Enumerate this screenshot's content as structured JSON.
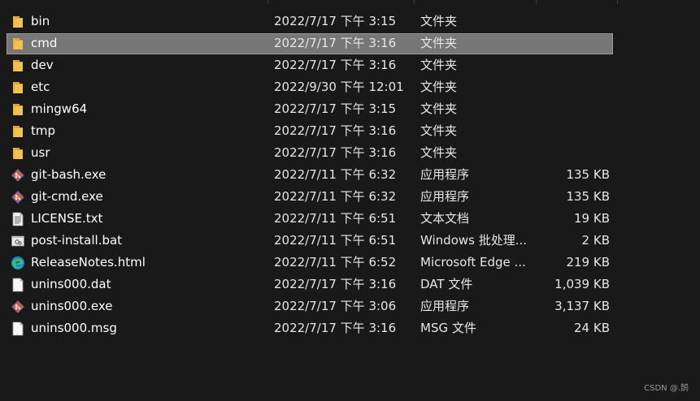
{
  "files": [
    {
      "name": "bin",
      "date": "2022/7/17 下午 3:15",
      "type": "文件夹",
      "size": "",
      "icon": "folder-icon"
    },
    {
      "name": "cmd",
      "date": "2022/7/17 下午 3:16",
      "type": "文件夹",
      "size": "",
      "icon": "folder-icon",
      "selected": true
    },
    {
      "name": "dev",
      "date": "2022/7/17 下午 3:16",
      "type": "文件夹",
      "size": "",
      "icon": "folder-icon"
    },
    {
      "name": "etc",
      "date": "2022/9/30 下午 12:01",
      "type": "文件夹",
      "size": "",
      "icon": "folder-icon"
    },
    {
      "name": "mingw64",
      "date": "2022/7/17 下午 3:15",
      "type": "文件夹",
      "size": "",
      "icon": "folder-icon"
    },
    {
      "name": "tmp",
      "date": "2022/7/17 下午 3:16",
      "type": "文件夹",
      "size": "",
      "icon": "folder-icon"
    },
    {
      "name": "usr",
      "date": "2022/7/17 下午 3:16",
      "type": "文件夹",
      "size": "",
      "icon": "folder-icon"
    },
    {
      "name": "git-bash.exe",
      "date": "2022/7/11 下午 6:32",
      "type": "应用程序",
      "size": "135 KB",
      "icon": "git-icon"
    },
    {
      "name": "git-cmd.exe",
      "date": "2022/7/11 下午 6:32",
      "type": "应用程序",
      "size": "135 KB",
      "icon": "git-icon"
    },
    {
      "name": "LICENSE.txt",
      "date": "2022/7/11 下午 6:51",
      "type": "文本文档",
      "size": "19 KB",
      "icon": "text-document-icon"
    },
    {
      "name": "post-install.bat",
      "date": "2022/7/11 下午 6:51",
      "type": "Windows 批处理...",
      "size": "2 KB",
      "icon": "batch-file-icon"
    },
    {
      "name": "ReleaseNotes.html",
      "date": "2022/7/11 下午 6:52",
      "type": "Microsoft Edge ...",
      "size": "219 KB",
      "icon": "edge-icon"
    },
    {
      "name": "unins000.dat",
      "date": "2022/7/17 下午 3:16",
      "type": "DAT 文件",
      "size": "1,039 KB",
      "icon": "blank-file-icon"
    },
    {
      "name": "unins000.exe",
      "date": "2022/7/17 下午 3:06",
      "type": "应用程序",
      "size": "3,137 KB",
      "icon": "git-icon"
    },
    {
      "name": "unins000.msg",
      "date": "2022/7/17 下午 3:16",
      "type": "MSG 文件",
      "size": "24 KB",
      "icon": "blank-file-icon"
    }
  ],
  "watermark": "CSDN @.鹄",
  "colors": {
    "background": "#191919",
    "selection": "#777777",
    "folder": "#f2c14e",
    "git": "#f05133"
  }
}
